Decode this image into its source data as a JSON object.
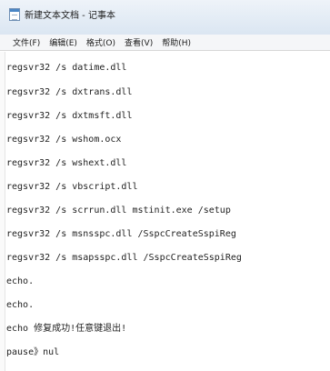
{
  "window": {
    "title": "新建文本文档 - 记事本"
  },
  "menu": [
    "文件(F)",
    "编辑(E)",
    "格式(O)",
    "查看(V)",
    "帮助(H)"
  ],
  "editor": {
    "lines": [
      "regsvr32 /s datime.dll",
      "regsvr32 /s dxtrans.dll",
      "regsvr32 /s dxtmsft.dll",
      "regsvr32 /s wshom.ocx",
      "regsvr32 /s wshext.dll",
      "regsvr32 /s vbscript.dll",
      "regsvr32 /s scrrun.dll mstinit.exe /setup",
      "regsvr32 /s msnsspc.dll /SspcCreateSspiReg",
      "regsvr32 /s msapsspc.dll /SspcCreateSspiReg",
      "echo.",
      "echo.",
      "echo 修复成功!任意键退出!",
      "pause》nul"
    ]
  }
}
